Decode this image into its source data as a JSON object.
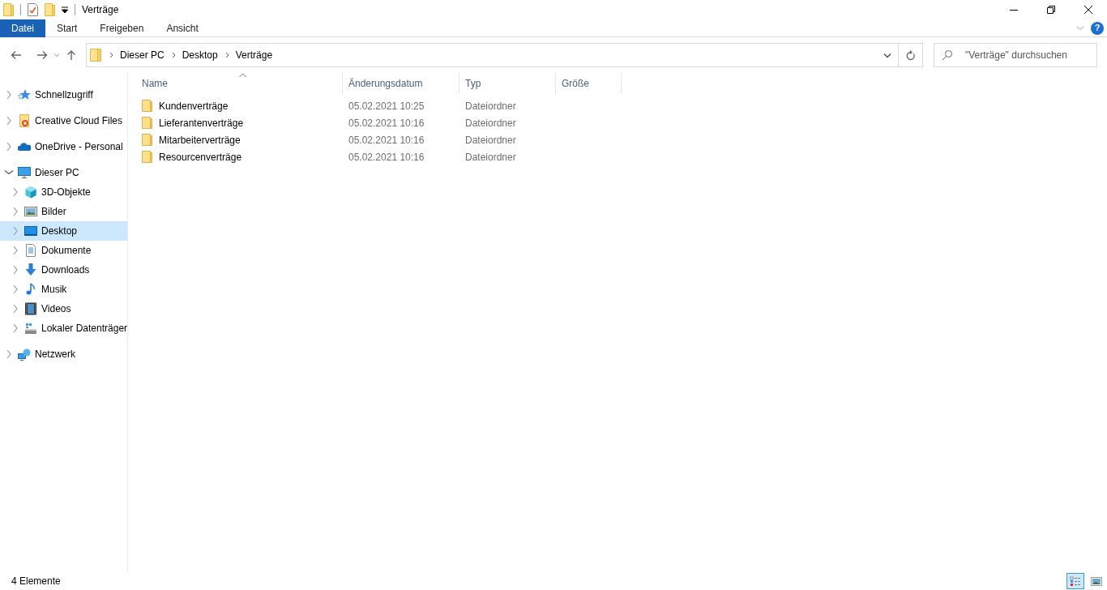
{
  "window": {
    "title": "Verträge"
  },
  "ribbon_tabs": [
    {
      "label": "Datei",
      "kind": "file",
      "selected": false
    },
    {
      "label": "Start",
      "kind": "tab",
      "selected": false
    },
    {
      "label": "Freigeben",
      "kind": "tab",
      "selected": false
    },
    {
      "label": "Ansicht",
      "kind": "tab",
      "selected": false
    }
  ],
  "help_button": {
    "label": "?"
  },
  "address": {
    "path": [
      "Dieser PC",
      "Desktop",
      "Verträge"
    ]
  },
  "search": {
    "placeholder": "\"Verträge\" durchsuchen"
  },
  "sidebar": {
    "items": [
      {
        "label": "Schnellzugriff",
        "kind": "star",
        "expanded": false,
        "selected": false
      },
      {
        "label": "Creative Cloud Files",
        "kind": "cloudfolder",
        "expanded": false,
        "selected": false
      },
      {
        "label": "OneDrive - Personal",
        "kind": "cloud",
        "expanded": false,
        "selected": false
      },
      {
        "label": "Dieser PC",
        "kind": "pc",
        "expanded": true,
        "selected": false,
        "children": [
          {
            "label": "3D-Objekte",
            "kind": "cube",
            "expanded": false,
            "selected": false
          },
          {
            "label": "Bilder",
            "kind": "picture",
            "expanded": false,
            "selected": false
          },
          {
            "label": "Desktop",
            "kind": "desktop",
            "expanded": false,
            "selected": true
          },
          {
            "label": "Dokumente",
            "kind": "document",
            "expanded": false,
            "selected": false
          },
          {
            "label": "Downloads",
            "kind": "download",
            "expanded": false,
            "selected": false
          },
          {
            "label": "Musik",
            "kind": "music",
            "expanded": false,
            "selected": false
          },
          {
            "label": "Videos",
            "kind": "film",
            "expanded": false,
            "selected": false
          },
          {
            "label": "Lokaler Datenträger",
            "kind": "drive",
            "expanded": false,
            "selected": false
          }
        ]
      },
      {
        "label": "Netzwerk",
        "kind": "network",
        "expanded": false,
        "selected": false
      }
    ]
  },
  "table": {
    "columns": [
      {
        "label": "Name",
        "sorted": true
      },
      {
        "label": "Änderungsdatum",
        "sorted": false
      },
      {
        "label": "Typ",
        "sorted": false
      },
      {
        "label": "Größe",
        "sorted": false
      }
    ],
    "rows": [
      {
        "name": "Kundenverträge",
        "date": "05.02.2021 10:25",
        "type": "Dateiordner"
      },
      {
        "name": "Lieferantenverträge",
        "date": "05.02.2021 10:16",
        "type": "Dateiordner"
      },
      {
        "name": "Mitarbeiterverträge",
        "date": "05.02.2021 10:16",
        "type": "Dateiordner"
      },
      {
        "name": "Resourcenverträge",
        "date": "05.02.2021 10:16",
        "type": "Dateiordner"
      }
    ]
  },
  "status_bar": {
    "text": "4 Elemente",
    "views": [
      {
        "kind": "details",
        "selected": true
      },
      {
        "kind": "large",
        "selected": false
      }
    ]
  }
}
